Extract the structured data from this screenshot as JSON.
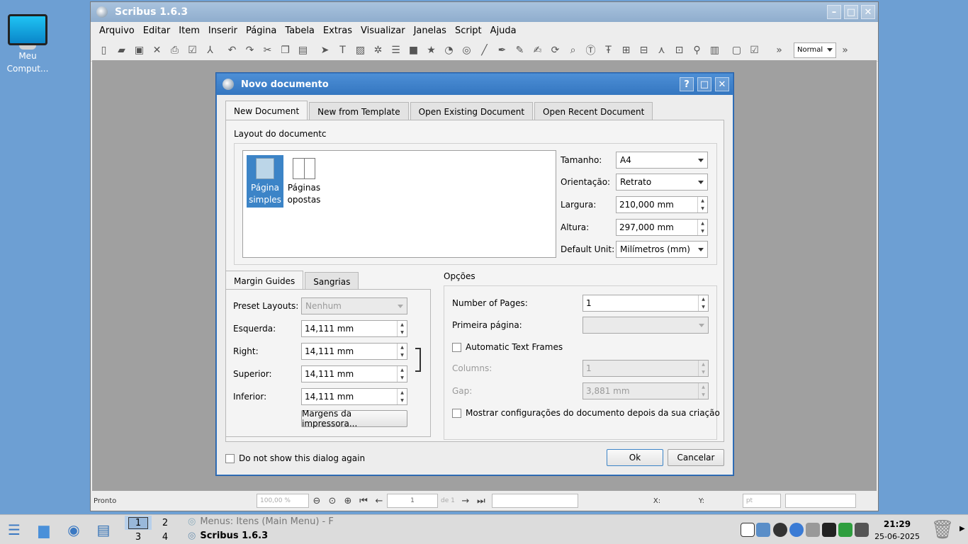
{
  "desktop": {
    "icon_label": "Meu Comput..."
  },
  "app": {
    "title": "Scribus 1.6.3",
    "menus": [
      "Arquivo",
      "Editar",
      "Item",
      "Inserir",
      "Página",
      "Tabela",
      "Extras",
      "Visualizar",
      "Janelas",
      "Script",
      "Ajuda"
    ],
    "mode": "Normal",
    "status": {
      "text": "Pronto",
      "zoom": "100,00 %",
      "page": "1",
      "of": "de 1",
      "x_label": "X:",
      "y_label": "Y:",
      "unit": "pt"
    }
  },
  "dialog": {
    "title": "Novo documento",
    "help": "?",
    "tabs": [
      "New Document",
      "New from Template",
      "Open Existing Document",
      "Open Recent Document"
    ],
    "layout_group": "Layout do documentc",
    "layouts": [
      {
        "line1": "Página",
        "line2": "simples"
      },
      {
        "line1": "Páginas",
        "line2": "opostas"
      }
    ],
    "size_label": "Tamanho:",
    "size_value": "A4",
    "orientation_label": "Orientação:",
    "orientation_value": "Retrato",
    "width_label": "Largura:",
    "width_value": "210,000 mm",
    "height_label": "Altura:",
    "height_value": "297,000 mm",
    "unit_label": "Default Unit:",
    "unit_value": "Milímetros (mm)",
    "margin_tabs": [
      "Margin Guides",
      "Sangrias"
    ],
    "preset_label": "Preset Layouts:",
    "preset_value": "Nenhum",
    "left_label": "Esquerda:",
    "left_value": "14,111 mm",
    "right_label": "Right:",
    "right_value": "14,111 mm",
    "top_label": "Superior:",
    "top_value": "14,111 mm",
    "bottom_label": "Inferior:",
    "bottom_value": "14,111 mm",
    "printer_margins": "Margens da impressora...",
    "options_label": "Opções",
    "pages_label": "Number of Pages:",
    "pages_value": "1",
    "first_page_label": "Primeira página:",
    "auto_frames_label": "Automatic Text Frames",
    "columns_label": "Columns:",
    "columns_value": "1",
    "gap_label": "Gap:",
    "gap_value": "3,881 mm",
    "show_settings_label": "Mostrar configurações do documento depois da sua criação",
    "dont_show_label": "Do not show this dialog again",
    "ok": "Ok",
    "cancel": "Cancelar"
  },
  "taskbar": {
    "workspaces": [
      "1",
      "2",
      "3",
      "4"
    ],
    "entries": [
      "Menus: Itens (Main Menu) - F",
      "Scribus 1.6.3"
    ],
    "time": "21:29",
    "date": "25-06-2025"
  }
}
